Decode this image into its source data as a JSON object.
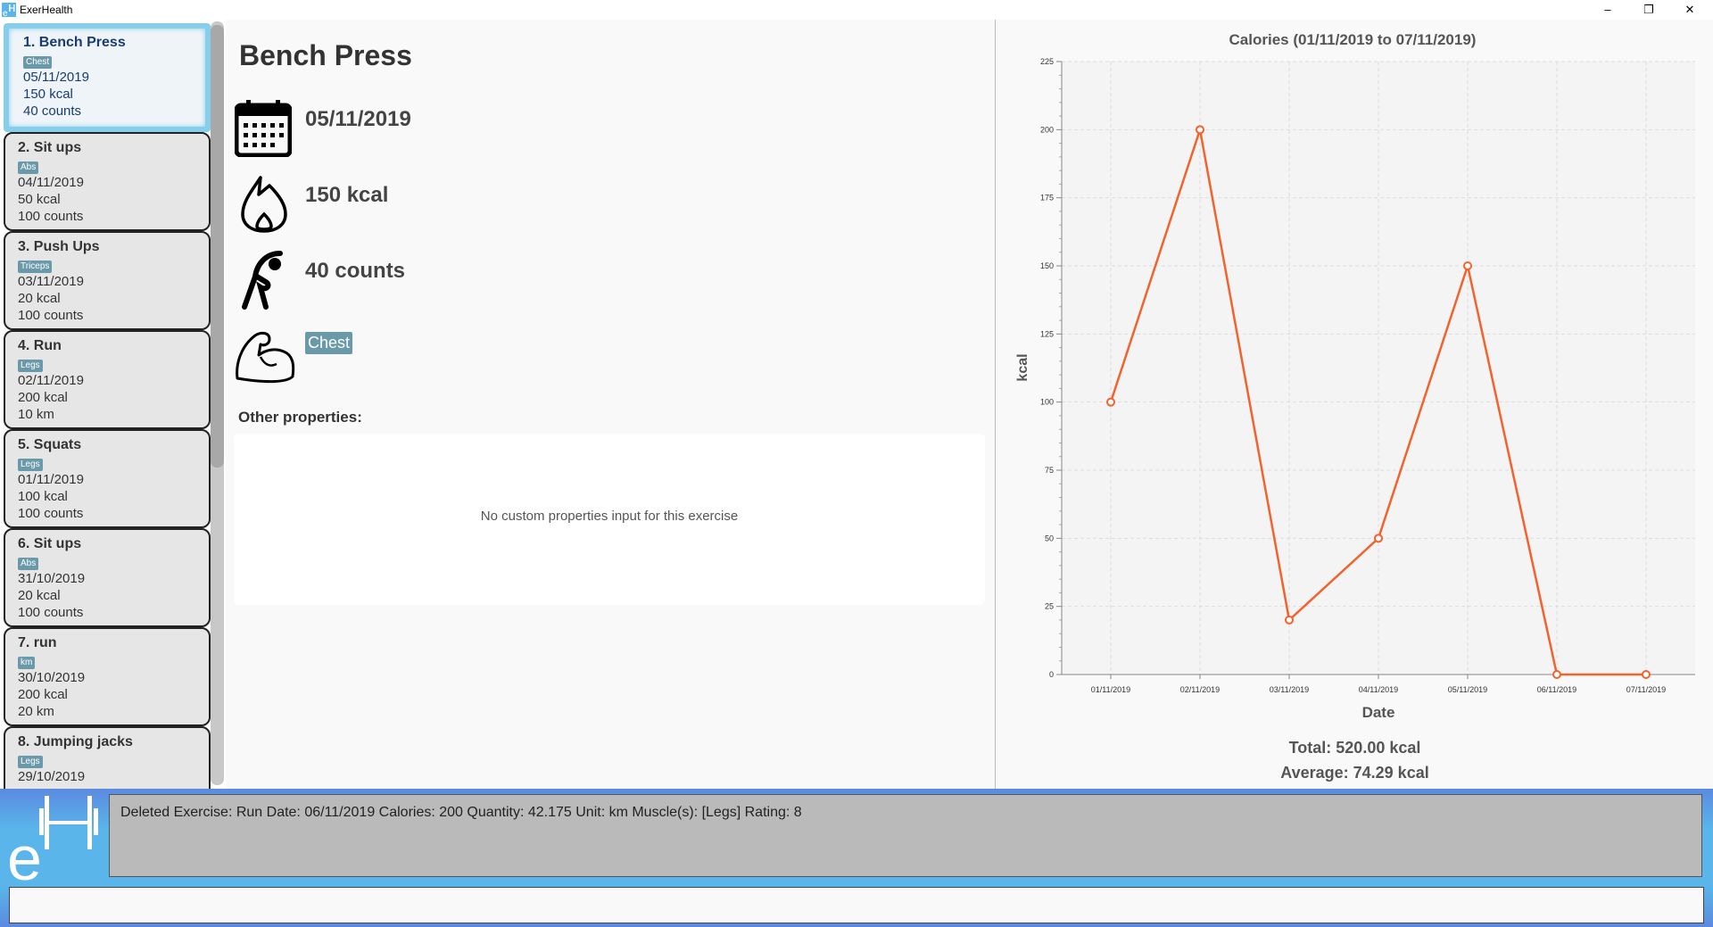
{
  "window": {
    "title": "ExerHealth",
    "minimize": "–",
    "restore": "❐",
    "close": "✕"
  },
  "exercises": [
    {
      "title": "1.  Bench Press",
      "tag": "Chest",
      "date": "05/11/2019",
      "calories": "150 kcal",
      "quantity": "40 counts"
    },
    {
      "title": "2.  Sit ups",
      "tag": "Abs",
      "date": "04/11/2019",
      "calories": "50 kcal",
      "quantity": "100 counts"
    },
    {
      "title": "3.  Push Ups",
      "tag": "Triceps",
      "date": "03/11/2019",
      "calories": "20 kcal",
      "quantity": "100 counts"
    },
    {
      "title": "4.  Run",
      "tag": "Legs",
      "date": "02/11/2019",
      "calories": "200 kcal",
      "quantity": "10 km"
    },
    {
      "title": "5.  Squats",
      "tag": "Legs",
      "date": "01/11/2019",
      "calories": "100 kcal",
      "quantity": "100 counts"
    },
    {
      "title": "6.  Sit ups",
      "tag": "Abs",
      "date": "31/10/2019",
      "calories": "20 kcal",
      "quantity": "100 counts"
    },
    {
      "title": "7.  run",
      "tag": "km",
      "date": "30/10/2019",
      "calories": "200 kcal",
      "quantity": "20 km"
    },
    {
      "title": "8.  Jumping jacks",
      "tag": "Legs",
      "date": "29/10/2019",
      "calories": "",
      "quantity": ""
    }
  ],
  "detail": {
    "name": "Bench Press",
    "date": "05/11/2019",
    "calories": "150 kcal",
    "quantity": "40 counts",
    "muscle": "Chest",
    "other_label": "Other properties:",
    "no_props": "No custom properties input for this exercise"
  },
  "result": "Deleted Exercise: Run Date: 06/11/2019 Calories: 200 Quantity: 42.175 Unit: km Muscle(s): [Legs] Rating: 8",
  "command": {
    "value": ""
  },
  "summary": {
    "total": "Total: 520.00 kcal",
    "average": "Average: 74.29 kcal"
  },
  "chart_data": {
    "type": "line",
    "title": "Calories (01/11/2019 to 07/11/2019)",
    "xlabel": "Date",
    "ylabel": "kcal",
    "categories": [
      "01/11/2019",
      "02/11/2019",
      "03/11/2019",
      "04/11/2019",
      "05/11/2019",
      "06/11/2019",
      "07/11/2019"
    ],
    "values": [
      100,
      200,
      20,
      50,
      150,
      0,
      0
    ],
    "ylim": [
      0,
      225
    ],
    "yticks": [
      0,
      25,
      50,
      75,
      100,
      125,
      150,
      175,
      200,
      225
    ],
    "grid": true,
    "color": "#f3622d"
  }
}
